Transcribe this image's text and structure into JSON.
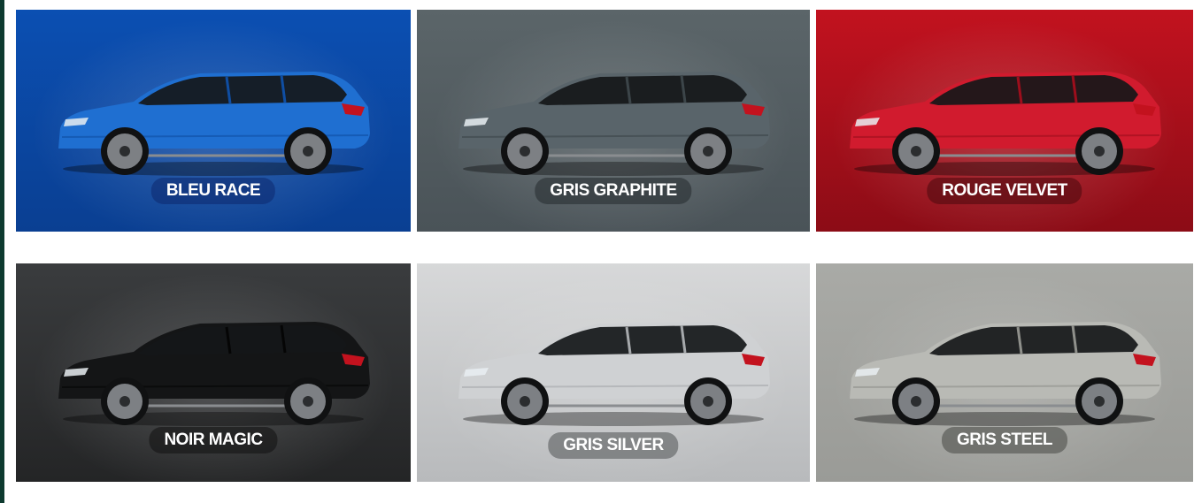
{
  "swatches": [
    {
      "label": "BLEU RACE",
      "body_color": "#1f6fd1",
      "body_dark": "#0f4ea3",
      "bg_top": "#0b4fb2",
      "bg_bottom": "#0a3f92",
      "label_bg": "rgba(12,40,110,0.55)"
    },
    {
      "label": "GRIS GRAPHITE",
      "body_color": "#59646a",
      "body_dark": "#3c4549",
      "bg_top": "#5b6569",
      "bg_bottom": "#4a5358",
      "label_bg": "rgba(40,46,50,0.6)"
    },
    {
      "label": "ROUGE VELVET",
      "body_color": "#d11b2e",
      "body_dark": "#9c0e1c",
      "bg_top": "#c2121f",
      "bg_bottom": "#8c0c16",
      "label_bg": "rgba(80,10,15,0.6)"
    },
    {
      "label": "NOIR MAGIC",
      "body_color": "#141516",
      "body_dark": "#050505",
      "bg_top": "#3a3c3e",
      "bg_bottom": "#242526",
      "label_bg": "rgba(20,20,20,0.6)"
    },
    {
      "label": "GRIS SILVER",
      "body_color": "#cfd1d3",
      "body_dark": "#a6a9ac",
      "bg_top": "#d7d8d9",
      "bg_bottom": "#b8babc",
      "label_bg": "rgba(110,112,114,0.75)"
    },
    {
      "label": "GRIS STEEL",
      "body_color": "#b9bab5",
      "body_dark": "#8f908b",
      "bg_top": "#a9aaa6",
      "bg_bottom": "#9a9b97",
      "label_bg": "rgba(95,96,92,0.75)"
    }
  ]
}
